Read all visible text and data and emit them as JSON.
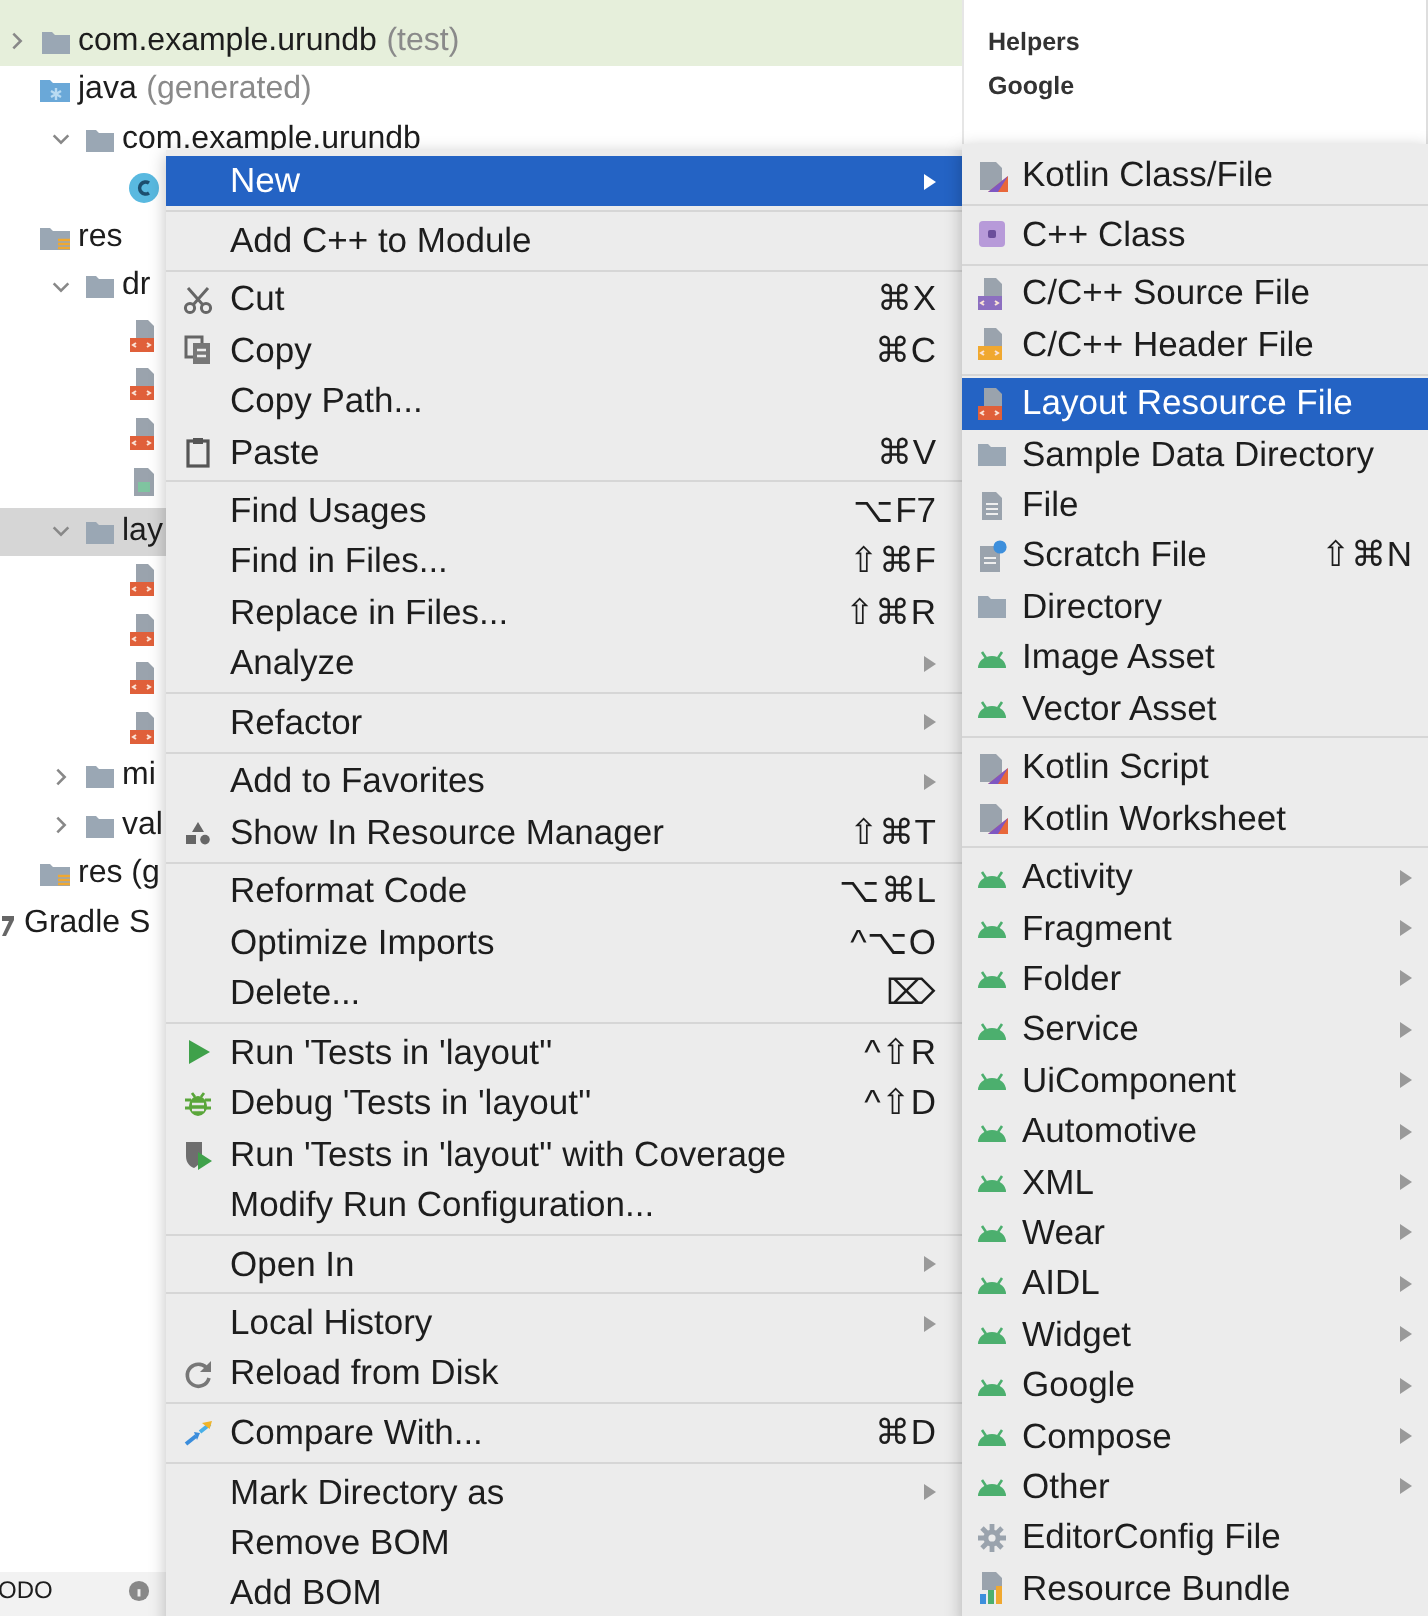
{
  "tree": {
    "items": [
      {
        "label": "com.example.urundb",
        "suffix": "(test)",
        "kind": "folder",
        "expanded": false,
        "selected": false,
        "color": "#e6efdb"
      },
      {
        "label": "java",
        "suffix": "(generated)",
        "kind": "java-generated",
        "selected": false,
        "children": [
          {
            "label": "com.example.urundb",
            "kind": "folder",
            "expanded": true,
            "selected": false,
            "children": [
              {
                "kind": "class",
                "selected": false
              }
            ]
          }
        ]
      },
      {
        "label": "res",
        "kind": "res",
        "selected": false,
        "children": [
          {
            "label": "dr",
            "kind": "folder",
            "expanded": true,
            "selected": false,
            "children": [
              {
                "kind": "xml-file",
                "selected": false
              },
              {
                "kind": "xml-file",
                "selected": false
              },
              {
                "kind": "xml-file",
                "selected": false
              },
              {
                "kind": "image-file",
                "selected": false
              }
            ]
          },
          {
            "label": "lay",
            "kind": "folder",
            "expanded": true,
            "selected": true,
            "children": [
              {
                "kind": "xml-file",
                "selected": false
              },
              {
                "kind": "xml-file",
                "selected": false
              },
              {
                "kind": "xml-file",
                "selected": false
              },
              {
                "kind": "xml-file",
                "selected": false
              }
            ]
          },
          {
            "label": "mi",
            "kind": "folder",
            "expanded": false,
            "selected": false
          },
          {
            "label": "val",
            "kind": "folder",
            "expanded": false,
            "selected": false
          }
        ]
      },
      {
        "label": "res (g",
        "kind": "res",
        "selected": false
      },
      {
        "label": "Gradle S",
        "kind": "gradle",
        "selected": false
      }
    ]
  },
  "bottom_bar": {
    "label": "ODO"
  },
  "side_panel": {
    "items": [
      {
        "label": "Helpers"
      },
      {
        "label": "Google"
      }
    ]
  },
  "context_menu": {
    "sections": [
      {
        "items": [
          {
            "label": "New",
            "selected": true,
            "submenu": true
          }
        ]
      },
      {
        "items": [
          {
            "label": "Add C++ to Module",
            "selected": false,
            "submenu": false
          }
        ]
      },
      {
        "items": [
          {
            "label": "Cut",
            "kind": "cut",
            "shortcut": "⌘X",
            "selected": false,
            "submenu": false
          },
          {
            "label": "Copy",
            "kind": "copy",
            "shortcut": "⌘C",
            "selected": false,
            "submenu": false
          },
          {
            "label": "Copy Path...",
            "selected": false,
            "submenu": false
          },
          {
            "label": "Paste",
            "kind": "paste",
            "shortcut": "⌘V",
            "selected": false,
            "submenu": false
          }
        ]
      },
      {
        "items": [
          {
            "label": "Find Usages",
            "shortcut": "⌥F7",
            "selected": false,
            "submenu": false
          },
          {
            "label": "Find in Files...",
            "shortcut": "⇧⌘F",
            "selected": false,
            "submenu": false
          },
          {
            "label": "Replace in Files...",
            "shortcut": "⇧⌘R",
            "selected": false,
            "submenu": false
          },
          {
            "label": "Analyze",
            "selected": false,
            "submenu": true
          }
        ]
      },
      {
        "items": [
          {
            "label": "Refactor",
            "selected": false,
            "submenu": true
          }
        ]
      },
      {
        "items": [
          {
            "label": "Add to Favorites",
            "selected": false,
            "submenu": true
          },
          {
            "label": "Show In Resource Manager",
            "kind": "resource-manager",
            "shortcut": "⇧⌘T",
            "selected": false,
            "submenu": false
          }
        ]
      },
      {
        "items": [
          {
            "label": "Reformat Code",
            "shortcut": "⌥⌘L",
            "selected": false,
            "submenu": false
          },
          {
            "label": "Optimize Imports",
            "shortcut": "^⌥O",
            "selected": false,
            "submenu": false
          },
          {
            "label": "Delete...",
            "shortcut": "⌦",
            "selected": false,
            "submenu": false
          }
        ]
      },
      {
        "items": [
          {
            "label": "Run 'Tests in 'layout''",
            "kind": "run",
            "shortcut": "^⇧R",
            "selected": false,
            "submenu": false
          },
          {
            "label": "Debug 'Tests in 'layout''",
            "kind": "debug",
            "shortcut": "^⇧D",
            "selected": false,
            "submenu": false
          },
          {
            "label": "Run 'Tests in 'layout'' with Coverage",
            "kind": "coverage",
            "selected": false,
            "submenu": false
          },
          {
            "label": "Modify Run Configuration...",
            "selected": false,
            "submenu": false
          }
        ]
      },
      {
        "items": [
          {
            "label": "Open In",
            "selected": false,
            "submenu": true
          }
        ]
      },
      {
        "items": [
          {
            "label": "Local History",
            "selected": false,
            "submenu": true
          },
          {
            "label": "Reload from Disk",
            "kind": "reload",
            "selected": false,
            "submenu": false
          }
        ]
      },
      {
        "items": [
          {
            "label": "Compare With...",
            "kind": "compare",
            "shortcut": "⌘D",
            "selected": false,
            "submenu": false
          }
        ]
      },
      {
        "items": [
          {
            "label": "Mark Directory as",
            "selected": false,
            "submenu": true
          },
          {
            "label": "Remove BOM",
            "selected": false,
            "submenu": false
          },
          {
            "label": "Add BOM",
            "selected": false,
            "submenu": false
          }
        ]
      }
    ]
  },
  "new_submenu": {
    "sections": [
      {
        "items": [
          {
            "label": "Kotlin Class/File",
            "kind": "kotlin",
            "selected": false,
            "submenu": false
          }
        ]
      },
      {
        "items": [
          {
            "label": "C++ Class",
            "kind": "cpp-class",
            "selected": false,
            "submenu": false
          }
        ]
      },
      {
        "items": [
          {
            "label": "C/C++ Source File",
            "kind": "cpp-source",
            "selected": false,
            "submenu": false
          },
          {
            "label": "C/C++ Header File",
            "kind": "cpp-header",
            "selected": false,
            "submenu": false
          }
        ]
      },
      {
        "items": [
          {
            "label": "Layout Resource File",
            "kind": "layout",
            "selected": true,
            "submenu": false
          },
          {
            "label": "Sample Data Directory",
            "kind": "folder",
            "selected": false,
            "submenu": false
          },
          {
            "label": "File",
            "kind": "file",
            "selected": false,
            "submenu": false
          },
          {
            "label": "Scratch File",
            "kind": "scratch",
            "shortcut": "⇧⌘N",
            "selected": false,
            "submenu": false
          },
          {
            "label": "Directory",
            "kind": "folder",
            "selected": false,
            "submenu": false
          },
          {
            "label": "Image Asset",
            "kind": "android",
            "selected": false,
            "submenu": false
          },
          {
            "label": "Vector Asset",
            "kind": "android",
            "selected": false,
            "submenu": false
          }
        ]
      },
      {
        "items": [
          {
            "label": "Kotlin Script",
            "kind": "kotlin",
            "selected": false,
            "submenu": false
          },
          {
            "label": "Kotlin Worksheet",
            "kind": "kotlin",
            "selected": false,
            "submenu": false
          }
        ]
      },
      {
        "items": [
          {
            "label": "Activity",
            "kind": "android",
            "selected": false,
            "submenu": true
          },
          {
            "label": "Fragment",
            "kind": "android",
            "selected": false,
            "submenu": true
          },
          {
            "label": "Folder",
            "kind": "android",
            "selected": false,
            "submenu": true
          },
          {
            "label": "Service",
            "kind": "android",
            "selected": false,
            "submenu": true
          },
          {
            "label": "UiComponent",
            "kind": "android",
            "selected": false,
            "submenu": true
          },
          {
            "label": "Automotive",
            "kind": "android",
            "selected": false,
            "submenu": true
          },
          {
            "label": "XML",
            "kind": "android",
            "selected": false,
            "submenu": true
          },
          {
            "label": "Wear",
            "kind": "android",
            "selected": false,
            "submenu": true
          },
          {
            "label": "AIDL",
            "kind": "android",
            "selected": false,
            "submenu": true
          },
          {
            "label": "Widget",
            "kind": "android",
            "selected": false,
            "submenu": true
          },
          {
            "label": "Google",
            "kind": "android",
            "selected": false,
            "submenu": true
          },
          {
            "label": "Compose",
            "kind": "android",
            "selected": false,
            "submenu": true
          },
          {
            "label": "Other",
            "kind": "android",
            "selected": false,
            "submenu": true
          },
          {
            "label": "EditorConfig File",
            "kind": "editorconfig",
            "selected": false,
            "submenu": false
          },
          {
            "label": "Resource Bundle",
            "kind": "resource-bundle",
            "selected": false,
            "submenu": false
          }
        ]
      }
    ]
  }
}
